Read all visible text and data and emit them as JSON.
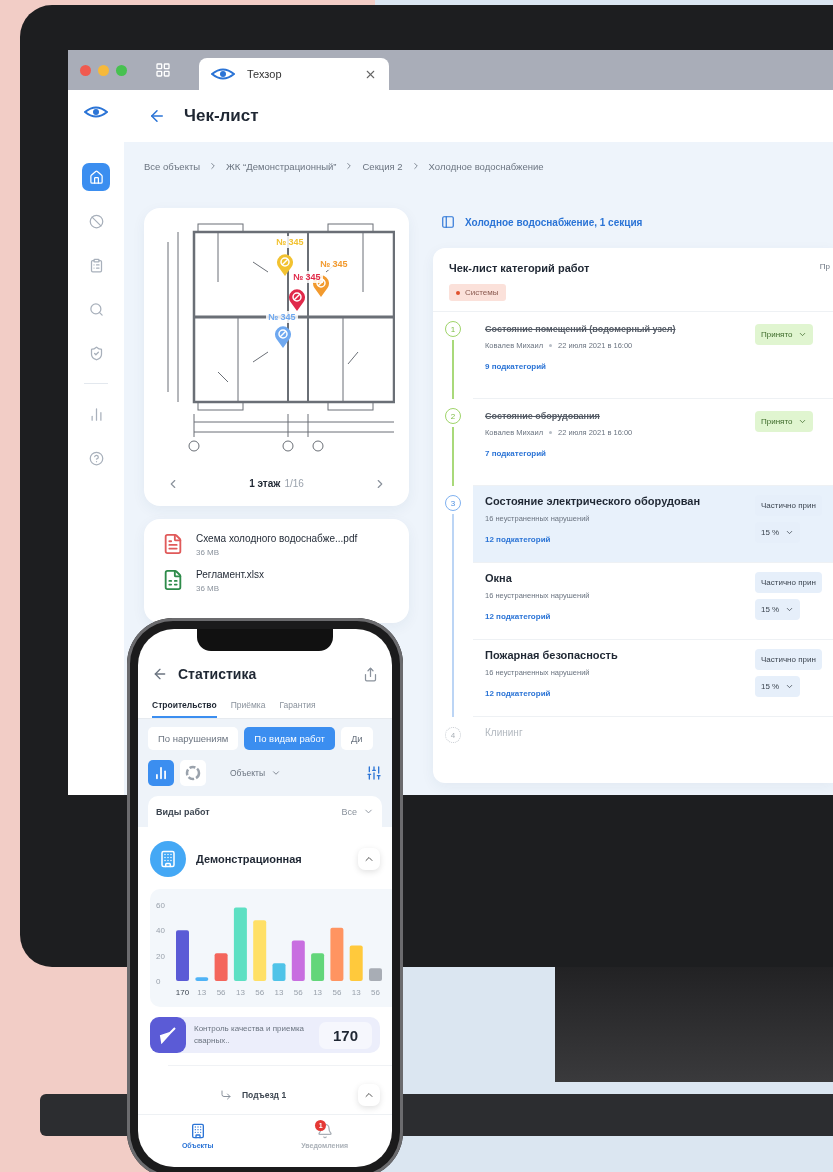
{
  "browser": {
    "tab": {
      "title": "Техзор"
    }
  },
  "header": {
    "title": "Чек-лист"
  },
  "sidebar": {
    "items": [
      {
        "selected": true
      },
      {
        "selected": false
      },
      {
        "selected": false
      },
      {
        "selected": false
      },
      {
        "selected": false
      },
      {
        "selected": false
      },
      {
        "selected": false
      }
    ]
  },
  "breadcrumbs": [
    "Все объекты",
    "ЖК “Демонстрационный”",
    "Секция 2",
    "Холодное водоснабжение"
  ],
  "plan": {
    "pins": [
      {
        "label": "№ 345",
        "color": "#f2c230"
      },
      {
        "label": "№ 345",
        "color": "#f29a2e"
      },
      {
        "label": "№ 345",
        "color": "#e0294a"
      },
      {
        "label": "№ 345",
        "color": "#6ea8f0"
      }
    ],
    "floor": "1 этаж",
    "page": "1/16"
  },
  "files": [
    {
      "kind": "pdf",
      "name": "Схема холодного водоснабже...pdf",
      "size": "36 MB"
    },
    {
      "kind": "xlsx",
      "name": "Регламент.xlsx",
      "size": "36 MB"
    }
  ],
  "section": {
    "title": "Холодное водоснабжение, 1 секция"
  },
  "checklist": {
    "title": "Чек-лист категорий работ",
    "column_2": "Пр",
    "tag": "Системы",
    "steps": [
      {
        "number": "1",
        "completed": true,
        "active": false,
        "items": [
          {
            "kind": "accepted",
            "selected": false,
            "title": "Состояние помещений (водомерный узел)",
            "author": "Ковалев Михаил",
            "date": "22 июля 2021 в 16:00",
            "status": "Принято",
            "subcategories": "9 подкатегорий"
          }
        ]
      },
      {
        "number": "2",
        "completed": true,
        "active": false,
        "items": [
          {
            "kind": "accepted",
            "selected": false,
            "title": "Состояние оборудования",
            "author": "Ковалев Михаил",
            "date": "22 июля 2021 в 16:00",
            "status": "Принято",
            "subcategories": "7 подкатегорий"
          }
        ]
      },
      {
        "number": "3",
        "completed": false,
        "active": true,
        "items": [
          {
            "kind": "partial",
            "selected": true,
            "title": "Состояние электрического оборудован",
            "violations": "16 неустраненных нарушений",
            "status": "Частично прин",
            "percent": "15 %",
            "subcategories": "12 подкатегорий"
          },
          {
            "kind": "partial",
            "selected": false,
            "title": "Окна",
            "violations": "16 неустраненных нарушений",
            "status": "Частично прин",
            "percent": "15 %",
            "subcategories": "12 подкатегорий"
          },
          {
            "kind": "partial",
            "selected": false,
            "title": "Пожарная безопасность",
            "violations": "16 неустраненных нарушений",
            "status": "Частично прин",
            "percent": "15 %",
            "subcategories": "12 подкатегорий"
          }
        ]
      },
      {
        "number": "4",
        "completed": false,
        "active": false,
        "title": "Клининг"
      }
    ]
  },
  "phone": {
    "title": "Статистика",
    "tabs": [
      {
        "label": "Строительство",
        "selected": true
      },
      {
        "label": "Приёмка",
        "selected": false
      },
      {
        "label": "Гарантия",
        "selected": false
      }
    ],
    "filters": [
      {
        "label": "По нарушениям",
        "selected": false
      },
      {
        "label": "По видам работ",
        "selected": true
      },
      {
        "label": "Ди",
        "selected": false
      }
    ],
    "views": [
      {
        "kind": "bar",
        "selected": true
      },
      {
        "kind": "donut",
        "selected": false
      }
    ],
    "objects_select": "Объекты",
    "work_types": {
      "label": "Виды работ",
      "value": "Все"
    },
    "object": {
      "title": "Демонстрационная"
    },
    "chart_data": {
      "type": "bar",
      "categories": [
        "170",
        "13",
        "56",
        "13",
        "56",
        "13",
        "56",
        "13",
        "56",
        "13",
        "56"
      ],
      "values": [
        40,
        3,
        22,
        58,
        48,
        14,
        32,
        22,
        42,
        28,
        10
      ],
      "ylim": [
        0,
        60
      ],
      "yticks": [
        0,
        20,
        40,
        60
      ]
    },
    "work_item": {
      "text": "Контроль качества и приемка сварных..",
      "value": "170"
    },
    "entrance": "Подъезд 1",
    "nav": [
      {
        "kind": "objects",
        "label": "Объекты",
        "selected": true
      },
      {
        "kind": "notifications",
        "label": "Уведомления",
        "selected": false,
        "badge": "1"
      }
    ]
  }
}
